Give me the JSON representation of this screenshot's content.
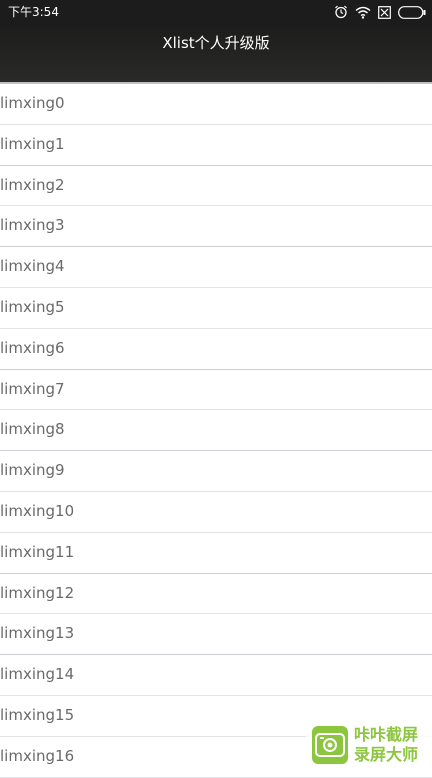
{
  "status_bar": {
    "time": "下午3:54",
    "icons": [
      "alarm-icon",
      "wifi-icon",
      "sim-off-icon",
      "battery-icon"
    ]
  },
  "title_bar": {
    "title": "Xlist个人升级版"
  },
  "list": {
    "items": [
      "limxing0",
      "limxing1",
      "limxing2",
      "limxing3",
      "limxing4",
      "limxing5",
      "limxing6",
      "limxing7",
      "limxing8",
      "limxing9",
      "limxing10",
      "limxing11",
      "limxing12",
      "limxing13",
      "limxing14",
      "limxing15",
      "limxing16"
    ]
  },
  "watermark": {
    "line1": "咔咔截屏",
    "line2": "录屏大师",
    "color": "#8cc63f"
  }
}
